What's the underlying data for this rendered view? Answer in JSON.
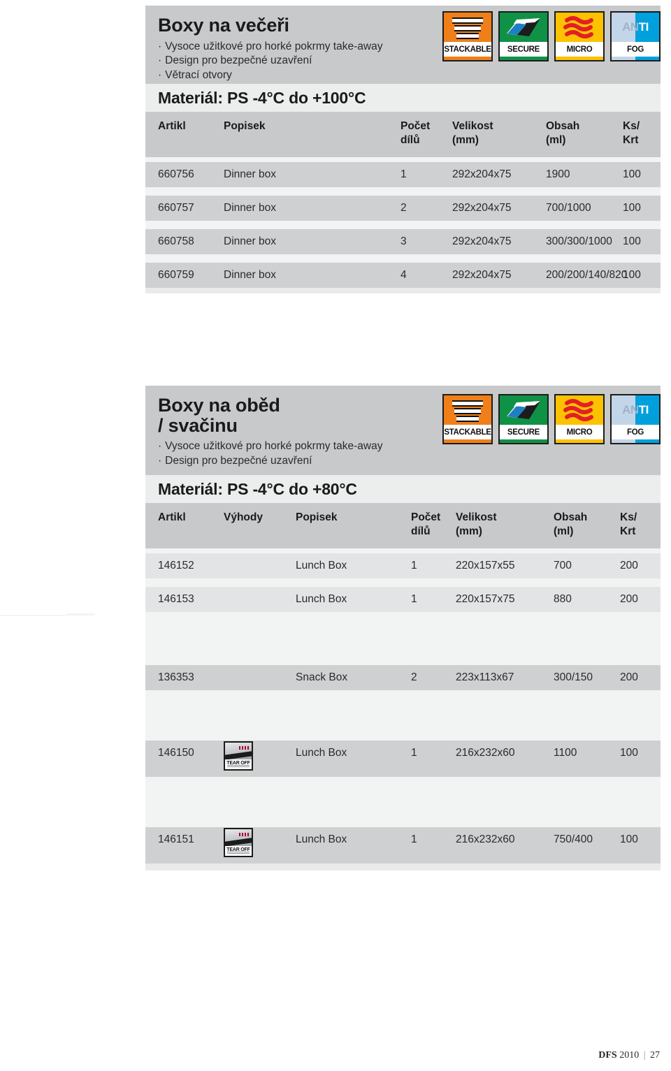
{
  "page": {
    "footer": {
      "brand": "DFS",
      "year": "2010",
      "separator": "|",
      "page_number": "27"
    }
  },
  "badges": [
    {
      "name": "stackable",
      "caption": "STACKABLE",
      "color": "#f07f1a"
    },
    {
      "name": "secure",
      "caption": "SECURE",
      "color": "#0f9246"
    },
    {
      "name": "micro",
      "caption": "MICRO",
      "color": "#fcc200"
    },
    {
      "name": "anti-fog",
      "caption": "FOG",
      "top_text_1": "AN",
      "top_text_2": "TI",
      "color": "#00a0dd"
    }
  ],
  "sections": [
    {
      "id": "dinner",
      "title_lines": [
        "Boxy na večeři"
      ],
      "bullets": [
        "Vysoce užitkové pro horké pokrmy take-away",
        "Design pro bezpečné uzavření",
        "Větrací otvory"
      ],
      "material": "Materiál: PS -4°C do +100°C",
      "columns": [
        {
          "key": "artikl",
          "label": "Artikl",
          "sub": ""
        },
        {
          "key": "popisek",
          "label": "Popisek",
          "sub": ""
        },
        {
          "key": "pocet",
          "label": "Počet",
          "sub": "dílů"
        },
        {
          "key": "velikost",
          "label": "Velikost",
          "sub": "(mm)"
        },
        {
          "key": "obsah",
          "label": "Obsah",
          "sub": "(ml)"
        },
        {
          "key": "kskrt",
          "label": "Ks/",
          "sub": "Krt"
        }
      ],
      "rows": [
        {
          "artikl": "660756",
          "popisek": "Dinner box",
          "pocet": "1",
          "velikost": "292x204x75",
          "obsah": "1900",
          "kskrt": "100"
        },
        {
          "artikl": "660757",
          "popisek": "Dinner box",
          "pocet": "2",
          "velikost": "292x204x75",
          "obsah": "700/1000",
          "kskrt": "100"
        },
        {
          "artikl": "660758",
          "popisek": "Dinner box",
          "pocet": "3",
          "velikost": "292x204x75",
          "obsah": "300/300/1000",
          "kskrt": "100"
        },
        {
          "artikl": "660759",
          "popisek": "Dinner box",
          "pocet": "4",
          "velikost": "292x204x75",
          "obsah": "200/200/140/820",
          "kskrt": "100"
        }
      ]
    },
    {
      "id": "lunch",
      "title_lines": [
        "Boxy na oběd",
        "/ svačinu"
      ],
      "bullets": [
        "Vysoce užitkové pro horké pokrmy take-away",
        "Design pro bezpečné uzavření"
      ],
      "material": "Materiál: PS -4°C do +80°C",
      "columns": [
        {
          "key": "artikl",
          "label": "Artikl",
          "sub": ""
        },
        {
          "key": "vyhody",
          "label": "Výhody",
          "sub": ""
        },
        {
          "key": "popisek",
          "label": "Popisek",
          "sub": ""
        },
        {
          "key": "pocet",
          "label": "Počet",
          "sub": "dílů"
        },
        {
          "key": "velikost",
          "label": "Velikost",
          "sub": "(mm)"
        },
        {
          "key": "obsah",
          "label": "Obsah",
          "sub": "(ml)"
        },
        {
          "key": "kskrt",
          "label": "Ks/",
          "sub": "Krt"
        }
      ],
      "rows": [
        {
          "artikl": "146152",
          "vyhody": "",
          "popisek": "Lunch Box",
          "pocet": "1",
          "velikost": "220x157x55",
          "obsah": "700",
          "kskrt": "200"
        },
        {
          "artikl": "146153",
          "vyhody": "",
          "popisek": "Lunch Box",
          "pocet": "1",
          "velikost": "220x157x75",
          "obsah": "880",
          "kskrt": "200"
        },
        {
          "artikl": "136353",
          "vyhody": "",
          "popisek": "Snack Box",
          "pocet": "2",
          "velikost": "223x113x67",
          "obsah": "300/150",
          "kskrt": "200"
        },
        {
          "artikl": "146150",
          "vyhody": "TEAR OFF",
          "popisek": "Lunch Box",
          "pocet": "1",
          "velikost": "216x232x60",
          "obsah": "1100",
          "kskrt": "100"
        },
        {
          "artikl": "146151",
          "vyhody": "TEAR OFF",
          "popisek": "Lunch Box",
          "pocet": "1",
          "velikost": "216x232x60",
          "obsah": "750/400",
          "kskrt": "100"
        }
      ]
    }
  ]
}
